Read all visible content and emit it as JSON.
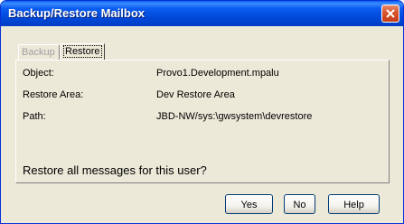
{
  "window": {
    "title": "Backup/Restore Mailbox"
  },
  "tabs": [
    {
      "label": "Backup",
      "active": false,
      "enabled": false
    },
    {
      "label": "Restore",
      "active": true,
      "enabled": true
    }
  ],
  "fields": {
    "object": {
      "label": "Object:",
      "value": "Provo1.Development.mpalu"
    },
    "restore_area": {
      "label": "Restore Area:",
      "value": "Dev Restore Area"
    },
    "path": {
      "label": "Path:",
      "value": "JBD-NW/sys:\\gwsystem\\devrestore"
    }
  },
  "prompt": "Restore all messages for this user?",
  "buttons": {
    "yes": "Yes",
    "no": "No",
    "help": "Help"
  },
  "colors": {
    "titlebar": "#0a5cf0",
    "dialog_bg": "#ece9d8",
    "close_button": "#d9532c"
  },
  "icons": {
    "close": "close-icon"
  }
}
